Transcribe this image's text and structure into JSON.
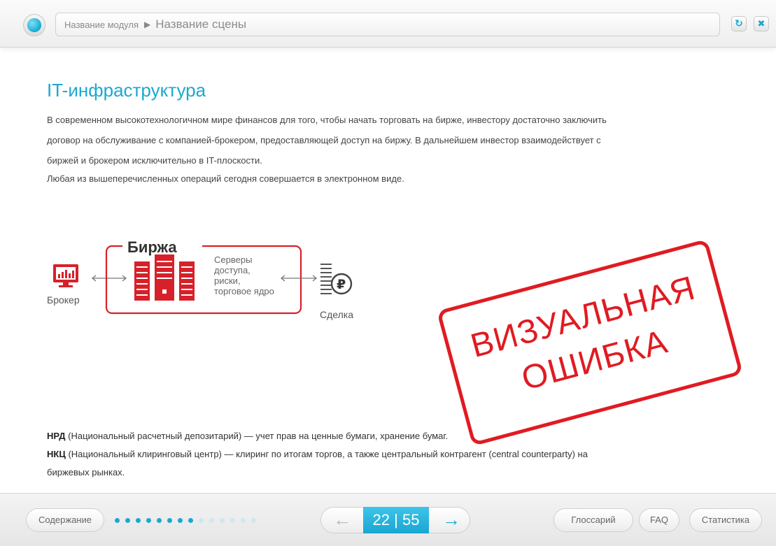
{
  "header": {
    "module_name": "Название модуля",
    "separator": "▶",
    "scene_name": "Название сцены",
    "refresh_icon": "refresh-icon",
    "close_icon": "close-icon"
  },
  "content": {
    "title": "IT-инфраструктура",
    "paragraph_lines": [
      "В современном высокотехнологичном мире финансов для того, чтобы начать торговать на бирже, инвестору достаточно заключить",
      "договор на обслуживание с компанией-брокером, предоставляющей доступ на биржу. В дальнейшем инвестор взаимодействует с",
      "биржей и брокером исключительно в IT-плоскости.",
      "Любая из вышеперечисленных операций сегодня совершается в электронном виде."
    ]
  },
  "diagram": {
    "exchange_label": "Биржа",
    "servers_lines": [
      "Серверы",
      "доступа,",
      "риски,",
      "торговое ядро"
    ],
    "broker_label": "Брокер",
    "deal_label": "Сделка",
    "ruble_symbol": "₽",
    "accent_color": "#d7212a"
  },
  "notes": {
    "nrd_term": "НРД",
    "nrd_text": " (Национальный расчетный депозитарий) — учет прав на ценные бумаги, хранение бумаг.",
    "nkc_term": "НКЦ",
    "nkc_text": " (Национальный клиринговый центр) — клиринг  по итогам торгов, а также центральный контрагент (central counterparty) на",
    "nkc_text_cont": "биржевых рынках."
  },
  "stamp": {
    "line1": "ВИЗУАЛЬНАЯ",
    "line2": "ОШИБКА",
    "color": "#e01b22"
  },
  "footer": {
    "contents_label": "Содержание",
    "progress": {
      "filled": 8,
      "total": 14
    },
    "page_current": "22",
    "page_sep": "|",
    "page_total": "55",
    "prev_icon": "arrow-left-icon",
    "next_icon": "arrow-right-icon",
    "glossary_label": "Глоссарий",
    "faq_label": "FAQ",
    "stats_label": "Статистика",
    "accent_color": "#1ba9cf"
  }
}
